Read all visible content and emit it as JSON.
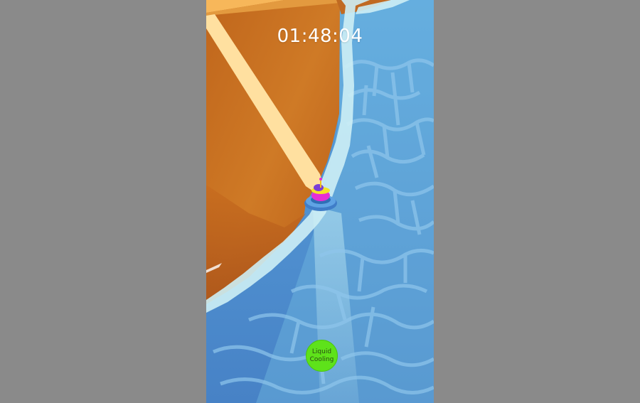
{
  "game": {
    "timer": "01:48:04",
    "ability_button": {
      "label": "Liquid Cooling",
      "color": "#5ee21a"
    }
  },
  "colors": {
    "background": "#8a8a8a",
    "water": "#4f8ccc",
    "foam": "#cdeef5",
    "cliff": "#c8701f",
    "path": "#ffe0a0",
    "timer_text": "#ffffff"
  }
}
